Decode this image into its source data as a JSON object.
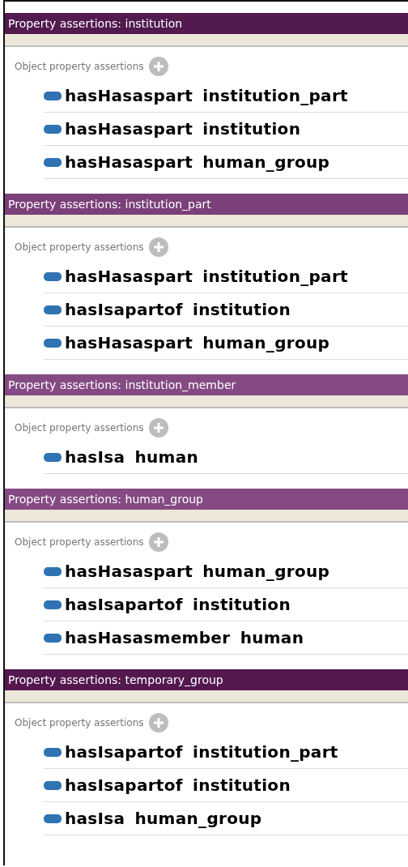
{
  "panels": [
    {
      "title": "Property assertions: institution",
      "color": "#521a4f",
      "section": "Object property assertions",
      "assertions": [
        "hasHasaspart institution_part",
        "hasHasaspart institution",
        "hasHasaspart human_group"
      ]
    },
    {
      "title": "Property assertions: institution_part",
      "color": "#7b3f79",
      "section": "Object property assertions",
      "assertions": [
        "hasHasaspart institution_part",
        "hasIsapartof institution",
        "hasHasaspart human_group"
      ]
    },
    {
      "title": "Property assertions: institution_member",
      "color": "#854a83",
      "section": "Object property assertions",
      "assertions": [
        "hasIsa human"
      ]
    },
    {
      "title": "Property assertions: human_group",
      "color": "#854a83",
      "section": "Object property assertions",
      "assertions": [
        "hasHasaspart human_group",
        "hasIsapartof institution",
        "hasHasasmember human"
      ]
    },
    {
      "title": "Property assertions: temporary_group",
      "color": "#54184f",
      "section": "Object property assertions",
      "assertions": [
        "hasIsapartof institution_part",
        "hasIsapartof institution",
        "hasIsa human_group"
      ]
    }
  ]
}
